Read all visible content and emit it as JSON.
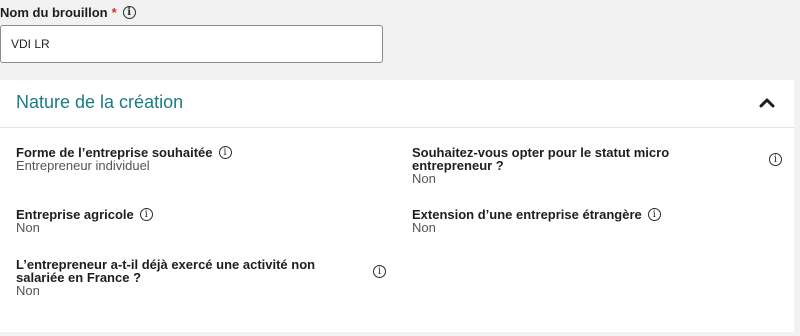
{
  "draft": {
    "label": "Nom du brouillon",
    "required_mark": "*",
    "value": "VDI LR"
  },
  "panel": {
    "title": "Nature de la création",
    "toggle_icon": "chevron-up-icon",
    "fields": [
      {
        "label": "Forme de l’entreprise souhaitée",
        "value": "Entrepreneur individuel"
      },
      {
        "label": "Souhaitez-vous opter pour le statut micro entrepreneur ?",
        "value": "Non"
      },
      {
        "label": "Entreprise agricole",
        "value": "Non"
      },
      {
        "label": "Extension d’une entreprise étrangère",
        "value": "Non"
      },
      {
        "label": "L’entrepreneur a-t-il déjà exercé une activité non salariée en France ?",
        "value": "Non"
      }
    ]
  },
  "icons": {
    "info": "info-icon"
  },
  "colors": {
    "accent": "#1a7b86",
    "required": "#d0342c"
  }
}
